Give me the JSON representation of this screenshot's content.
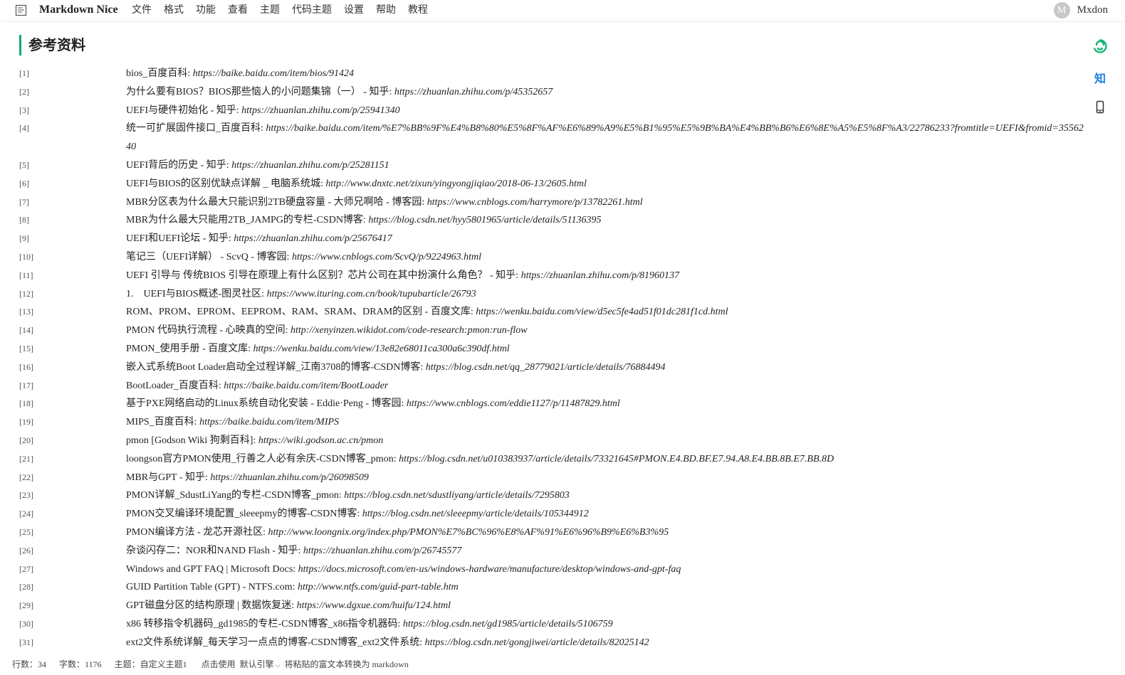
{
  "app": {
    "brand": "Markdown Nice",
    "menu": [
      "文件",
      "格式",
      "功能",
      "查看",
      "主题",
      "代码主题",
      "设置",
      "帮助",
      "教程"
    ],
    "user": {
      "avatar_letter": "M",
      "name": "Mxdon"
    }
  },
  "heading": "参考资料",
  "side_icons": {
    "zhihu": "知"
  },
  "references": [
    {
      "num": "[1]",
      "title": "bios_百度百科: ",
      "url": "https://baike.baidu.com/item/bios/91424"
    },
    {
      "num": "[2]",
      "title": "为什么要有BIOS？BIOS那些恼人的小问题集锦（一） - 知乎: ",
      "url": "https://zhuanlan.zhihu.com/p/45352657"
    },
    {
      "num": "[3]",
      "title": "UEFI与硬件初始化 - 知乎: ",
      "url": "https://zhuanlan.zhihu.com/p/25941340"
    },
    {
      "num": "[4]",
      "title": "统一可扩展固件接口_百度百科: ",
      "url": "https://baike.baidu.com/item/%E7%BB%9F%E4%B8%80%E5%8F%AF%E6%89%A9%E5%B1%95%E5%9B%BA%E4%BB%B6%E6%8E%A5%E5%8F%A3/22786233?fromtitle=UEFI&fromid=3556240"
    },
    {
      "num": "[5]",
      "title": "UEFI背后的历史 - 知乎: ",
      "url": "https://zhuanlan.zhihu.com/p/25281151"
    },
    {
      "num": "[6]",
      "title": "UEFI与BIOS的区别优缺点详解 _ 电脑系统城: ",
      "url": "http://www.dnxtc.net/zixun/yingyongjiqiao/2018-06-13/2605.html"
    },
    {
      "num": "[7]",
      "title": "MBR分区表为什么最大只能识别2TB硬盘容量 - 大师兄啊哈 - 博客园: ",
      "url": "https://www.cnblogs.com/harrymore/p/13782261.html"
    },
    {
      "num": "[8]",
      "title": "MBR为什么最大只能用2TB_JAMPG的专栏-CSDN博客: ",
      "url": "https://blog.csdn.net/hyy5801965/article/details/51136395"
    },
    {
      "num": "[9]",
      "title": "UEFI和UEFI论坛 - 知乎: ",
      "url": "https://zhuanlan.zhihu.com/p/25676417"
    },
    {
      "num": "[10]",
      "title": "笔记三（UEFI详解） - ScvQ - 博客园: ",
      "url": "https://www.cnblogs.com/ScvQ/p/9224963.html"
    },
    {
      "num": "[11]",
      "title": "UEFI 引导与 传统BIOS 引导在原理上有什么区别？芯片公司在其中扮演什么角色？ - 知乎: ",
      "url": "https://zhuanlan.zhihu.com/p/81960137"
    },
    {
      "num": "[12]",
      "title": "1.    UEFI与BIOS概述-图灵社区: ",
      "url": "https://www.ituring.com.cn/book/tupubarticle/26793"
    },
    {
      "num": "[13]",
      "title": "ROM、PROM、EPROM、EEPROM、RAM、SRAM、DRAM的区别 - 百度文库: ",
      "url": "https://wenku.baidu.com/view/d5ec5fe4ad51f01dc281f1cd.html"
    },
    {
      "num": "[14]",
      "title": "PMON 代码执行流程 - 心映真的空间: ",
      "url": "http://xenyinzen.wikidot.com/code-research:pmon:run-flow"
    },
    {
      "num": "[15]",
      "title": "PMON_使用手册 - 百度文库: ",
      "url": "https://wenku.baidu.com/view/13e82e68011ca300a6c390df.html"
    },
    {
      "num": "[16]",
      "title": "嵌入式系统Boot Loader启动全过程详解_江南3708的博客-CSDN博客: ",
      "url": "https://blog.csdn.net/qq_28779021/article/details/76884494"
    },
    {
      "num": "[17]",
      "title": "BootLoader_百度百科: ",
      "url": "https://baike.baidu.com/item/BootLoader"
    },
    {
      "num": "[18]",
      "title": "基于PXE网络启动的Linux系统自动化安装 - Eddie·Peng - 博客园: ",
      "url": "https://www.cnblogs.com/eddie1127/p/11487829.html"
    },
    {
      "num": "[19]",
      "title": "MIPS_百度百科: ",
      "url": "https://baike.baidu.com/item/MIPS"
    },
    {
      "num": "[20]",
      "title": "pmon [Godson Wiki 狗剩百科]: ",
      "url": "https://wiki.godson.ac.cn/pmon"
    },
    {
      "num": "[21]",
      "title": "loongson官方PMON使用_行善之人必有余庆-CSDN博客_pmon: ",
      "url": "https://blog.csdn.net/u010383937/article/details/73321645#PMON.E4.BD.BF.E7.94.A8.E4.BB.8B.E7.BB.8D"
    },
    {
      "num": "[22]",
      "title": "MBR与GPT - 知乎: ",
      "url": "https://zhuanlan.zhihu.com/p/26098509"
    },
    {
      "num": "[23]",
      "title": "PMON详解_SdustLiYang的专栏-CSDN博客_pmon: ",
      "url": "https://blog.csdn.net/sdustliyang/article/details/7295803"
    },
    {
      "num": "[24]",
      "title": "PMON交叉编译环境配置_sleeepmy的博客-CSDN博客: ",
      "url": "https://blog.csdn.net/sleeepmy/article/details/105344912"
    },
    {
      "num": "[25]",
      "title": "PMON编译方法 - 龙芯开源社区: ",
      "url": "http://www.loongnix.org/index.php/PMON%E7%BC%96%E8%AF%91%E6%96%B9%E6%B3%95"
    },
    {
      "num": "[26]",
      "title": "杂谈闪存二：NOR和NAND Flash - 知乎: ",
      "url": "https://zhuanlan.zhihu.com/p/26745577"
    },
    {
      "num": "[27]",
      "title": "Windows and GPT FAQ | Microsoft Docs: ",
      "url": "https://docs.microsoft.com/en-us/windows-hardware/manufacture/desktop/windows-and-gpt-faq"
    },
    {
      "num": "[28]",
      "title": "GUID Partition Table (GPT) - NTFS.com: ",
      "url": "http://www.ntfs.com/guid-part-table.htm"
    },
    {
      "num": "[29]",
      "title": "GPT磁盘分区的结构原理 | 数据恢复迷: ",
      "url": "https://www.dgxue.com/huifu/124.html"
    },
    {
      "num": "[30]",
      "title": "x86 转移指令机器码_gd1985的专栏-CSDN博客_x86指令机器码: ",
      "url": "https://blog.csdn.net/gd1985/article/details/5106759"
    },
    {
      "num": "[31]",
      "title": "ext2文件系统详解_每天学习一点点的博客-CSDN博客_ext2文件系统: ",
      "url": "https://blog.csdn.net/gongjiwei/article/details/82025142"
    }
  ],
  "statusbar": {
    "lines": "行数：34",
    "words": "字数：1176",
    "theme": "主题：自定义主题1",
    "click_use": "点击使用",
    "engine": "默认引擎",
    "paste": "将粘贴的富文本转换为 markdown"
  }
}
